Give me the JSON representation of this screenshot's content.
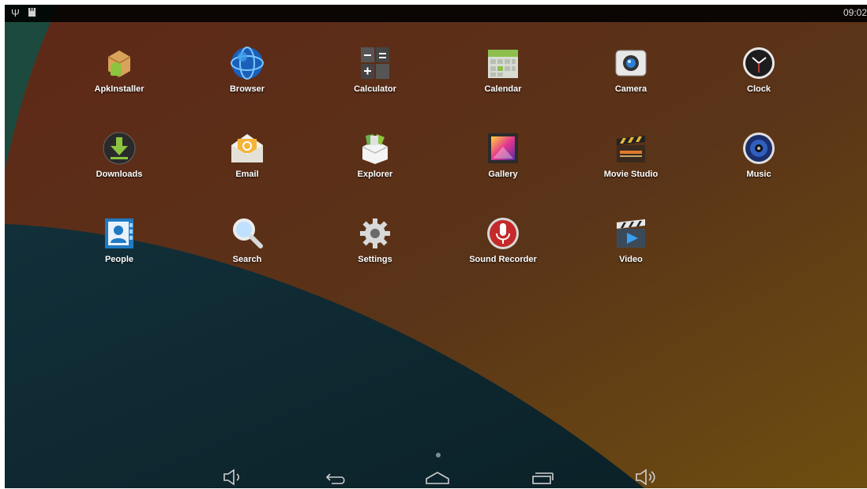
{
  "status_bar": {
    "usb_icon": "usb-icon",
    "storage_icon": "sd-card-icon",
    "time": "09:02"
  },
  "apps": [
    {
      "label": "ApkInstaller",
      "icon": "apkinstaller-icon"
    },
    {
      "label": "Browser",
      "icon": "browser-icon"
    },
    {
      "label": "Calculator",
      "icon": "calculator-icon"
    },
    {
      "label": "Calendar",
      "icon": "calendar-icon"
    },
    {
      "label": "Camera",
      "icon": "camera-icon"
    },
    {
      "label": "Clock",
      "icon": "clock-icon"
    },
    {
      "label": "Downloads",
      "icon": "downloads-icon"
    },
    {
      "label": "Email",
      "icon": "email-icon"
    },
    {
      "label": "Explorer",
      "icon": "explorer-icon"
    },
    {
      "label": "Gallery",
      "icon": "gallery-icon"
    },
    {
      "label": "Movie Studio",
      "icon": "movie-studio-icon"
    },
    {
      "label": "Music",
      "icon": "music-icon"
    },
    {
      "label": "People",
      "icon": "people-icon"
    },
    {
      "label": "Search",
      "icon": "search-icon"
    },
    {
      "label": "Settings",
      "icon": "settings-icon"
    },
    {
      "label": "Sound Recorder",
      "icon": "sound-recorder-icon"
    },
    {
      "label": "Video",
      "icon": "video-icon"
    }
  ],
  "nav_bar": {
    "buttons": [
      "volume-down-icon",
      "back-icon",
      "home-icon",
      "recent-apps-icon",
      "volume-up-icon"
    ]
  },
  "colors": {
    "wallpaper_top": "#5a2f1c",
    "wallpaper_bottom": "#6b4a12",
    "wallpaper_teal": "#0e2a33"
  }
}
